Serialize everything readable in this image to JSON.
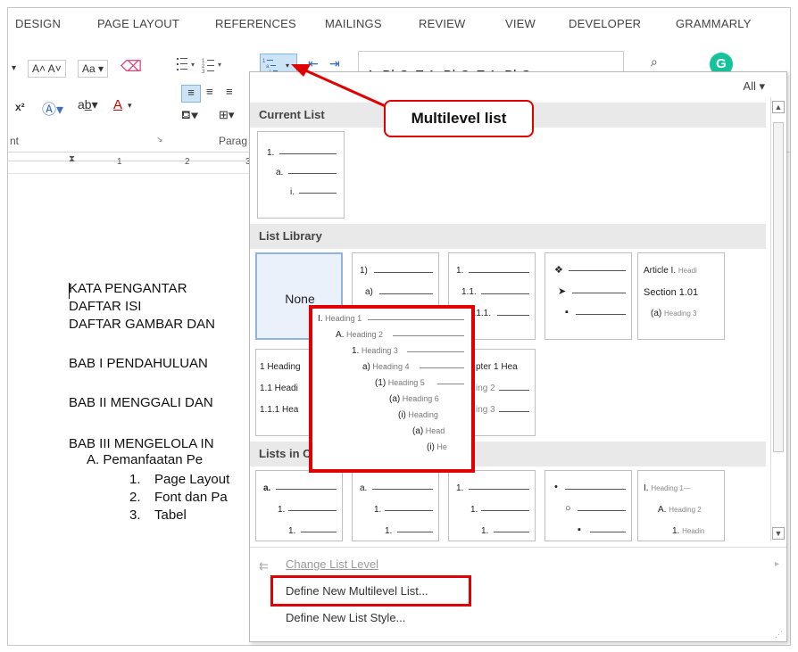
{
  "tabs": [
    "DESIGN",
    "PAGE LAYOUT",
    "REFERENCES",
    "MAILINGS",
    "REVIEW",
    "VIEW",
    "DEVELOPER",
    "GRAMMARLY"
  ],
  "ribbon": {
    "font_group_label": "nt",
    "paragraph_group_label": "Parag",
    "styles_preview": "AaBbCcE  AaBbCcE  AaBbC"
  },
  "ruler": {
    "ticks": [
      "1",
      "2",
      "3"
    ]
  },
  "document": {
    "lines": [
      "KATA PENGANTAR",
      "DAFTAR ISI",
      "DAFTAR GAMBAR DAN",
      "BAB I PENDAHULUAN",
      "BAB II MENGGALI DAN",
      "BAB III MENGELOLA IN"
    ],
    "sub_heading": "A.  Pemanfaatan Pe",
    "items": [
      {
        "num": "1.",
        "text": "Page Layout"
      },
      {
        "num": "2.",
        "text": "Font dan Pa"
      },
      {
        "num": "3.",
        "text": "Tabel"
      }
    ]
  },
  "dropdown": {
    "filter": "All",
    "current_list_header": "Current List",
    "list_library_header": "List Library",
    "lists_in_docs_header": "Lists in C",
    "none_label": "None",
    "lib_row1": {
      "t2": [
        "1)",
        "a)",
        "i)"
      ],
      "t3": [
        "1.",
        "1.1.",
        "1.1.1."
      ],
      "t5": [
        "Article I.",
        "Section 1.01",
        "(a)"
      ],
      "t5_gray": [
        "Headi",
        "",
        "Heading 3"
      ]
    },
    "lib_row2": {
      "t1": [
        "1 Heading",
        "1.1 Headi",
        "1.1.1 Hea"
      ],
      "t2": [
        "pter 1 Hea",
        "ing 2",
        "ing 3"
      ]
    },
    "change_level": "Change List Level",
    "define_multilevel": "Define New Multilevel List...",
    "define_style": "Define New List Style..."
  },
  "callout": "Multilevel list",
  "preview": {
    "rows": [
      {
        "num": "I.",
        "text": "Heading 1"
      },
      {
        "num": "A.",
        "text": "Heading 2"
      },
      {
        "num": "1.",
        "text": "Heading 3"
      },
      {
        "num": "a)",
        "text": "Heading 4"
      },
      {
        "num": "(1)",
        "text": "Heading 5"
      },
      {
        "num": "(a)",
        "text": "Heading 6"
      },
      {
        "num": "(i)",
        "text": "Heading"
      },
      {
        "num": "(a)",
        "text": "Head"
      },
      {
        "num": "(i)",
        "text": "He"
      }
    ]
  },
  "colors": {
    "highlight": "#e00000",
    "selected_border": "#8fb4e0",
    "header_bg": "#e9e9e9",
    "grammarly": "#15c39a"
  }
}
